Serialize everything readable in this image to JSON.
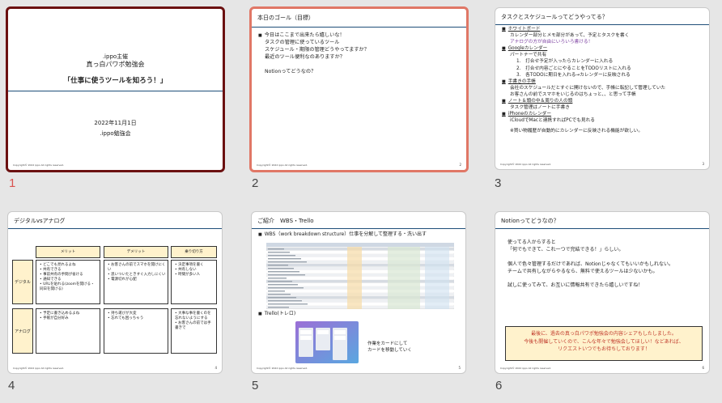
{
  "slides": [
    {
      "number": "1",
      "cover": {
        "org": ".ippo主催",
        "event": "真っ白パワポ勉強会",
        "headline": "「仕事に使うツールを知ろう！」",
        "date": "2022年11月1日",
        "host": ".ippo勉強会"
      },
      "footer": "Copyright© 2022 ippo All rights reserved."
    },
    {
      "number": "2",
      "title": "本日のゴール（目標）",
      "lines": [
        "今日はここまで出来たら嬉しいな！",
        "タスクの管理に使っているツール",
        "スケジュール・期限の管理どうやってますか？",
        "最近のツール便利なのありますか？",
        "Notionってどうなの？"
      ],
      "page": "2",
      "footer": "Copyright© 2022 ippo All rights reserved."
    },
    {
      "number": "3",
      "title": "タスクとスケジュールってどうやってる？",
      "items": [
        {
          "head": "ホワイトボード",
          "lines": [
            "カレンダー部分とメモ部分があって、予定とタスクを書く",
            "アナログの方が自由にいろいろ書ける！"
          ]
        },
        {
          "head": "Googleカレンダー",
          "lines": [
            "パートナーで共有",
            "1.　打合せ予定が入ったらカレンダーに入れる",
            "2.　打合せ内容ごとにやることをTODOリストに入れる",
            "3.　各TODOに期日を入れる→カレンダーに反映される"
          ]
        },
        {
          "head": "手書きの手帳",
          "lines": [
            "会社のスケジュールだとすぐに開けないので、手帳に転記して管理していた",
            "お客さんの前でスマホをいじるのはちょっと、、と思って手帳"
          ]
        },
        {
          "head": "ノート＆頭の中＆周りの人の頭",
          "lines": [
            "タスク管理はノートに手書き"
          ]
        },
        {
          "head": "iPhoneのカレンダー",
          "lines": [
            "iCloudでMacと連携すればPCでも見れる"
          ]
        }
      ],
      "note": "※買い物履歴が自動的にカレンダーに反映される機能が欲しい。",
      "page": "3",
      "footer": "Copyright© 2022 ippo All rights reserved."
    },
    {
      "number": "4",
      "title": "デジタルvsアナログ",
      "columns": [
        "メリット",
        "デメリット",
        "乗り切り方"
      ],
      "rows": [
        {
          "label": "デジタル",
          "cells": [
            [
              "どこでも見れるよね",
              "共有できる",
              "事前共有の手間が省ける",
              "通知できる",
              "URLを貼れる(zoomを開ける・同日を開ける)"
            ],
            [
              "お客さんの前でスマホを開けにくい",
              "思いついたときすぐ入力しにくい",
              "電源切れが心配"
            ],
            [
              "決定事項を書く",
              "共有しない",
              "時間が多い人"
            ]
          ]
        },
        {
          "label": "アナログ",
          "cells": [
            [
              "予定に書き込めるよね",
              "手帳が自分好み"
            ],
            [
              "持ち運びが大変",
              "忘れても困っちゃう"
            ],
            [
              "大事な事を書くのを忘れないようにする",
              "お客さんの前では手書きで"
            ]
          ]
        }
      ],
      "page": "4",
      "footer": "Copyright© 2022 ippo All rights reserved."
    },
    {
      "number": "5",
      "title": "ご紹介　WBS・Trello",
      "wbs": "WBS（work breakdown structure）仕事を分解して整理する・洗い出す",
      "trello": "Trello(トレロ)",
      "card_note": [
        "作業をカードにして",
        "カードを移動していく"
      ],
      "page": "5",
      "footer": "Copyright© 2022 ippo All rights reserved."
    },
    {
      "number": "6",
      "title": "Notionってどうなの？",
      "lines": [
        "使ってる人からすると",
        "「何でもできて、これ一つで完結できる！」らしい。",
        "",
        "個人で色々管理するだけであれば、Notionじゃなくてもいいかもしれない。",
        "チームで共有しながらやるなら、無料で使えるツールは少ないかも。",
        "",
        "試しに使ってみて、お互いに情報共有できたら嬉しいですね！"
      ],
      "closing": [
        "最後に、過去の真っ白パワポ勉強会の内容シェアもしたしました。",
        "今後も開催していくので、こんな年々で勉強会してほしい！などあれば、",
        "リクエストいつでもお待ちしております！"
      ],
      "page": "6",
      "footer": "Copyright© 2022 ippo All rights reserved."
    }
  ],
  "colors": {
    "selected_border": "#6b1010",
    "hover_border": "#e07766",
    "active_number": "#d9534f",
    "title_rule": "#1f4e79",
    "table_fill": "#fff2cc"
  }
}
